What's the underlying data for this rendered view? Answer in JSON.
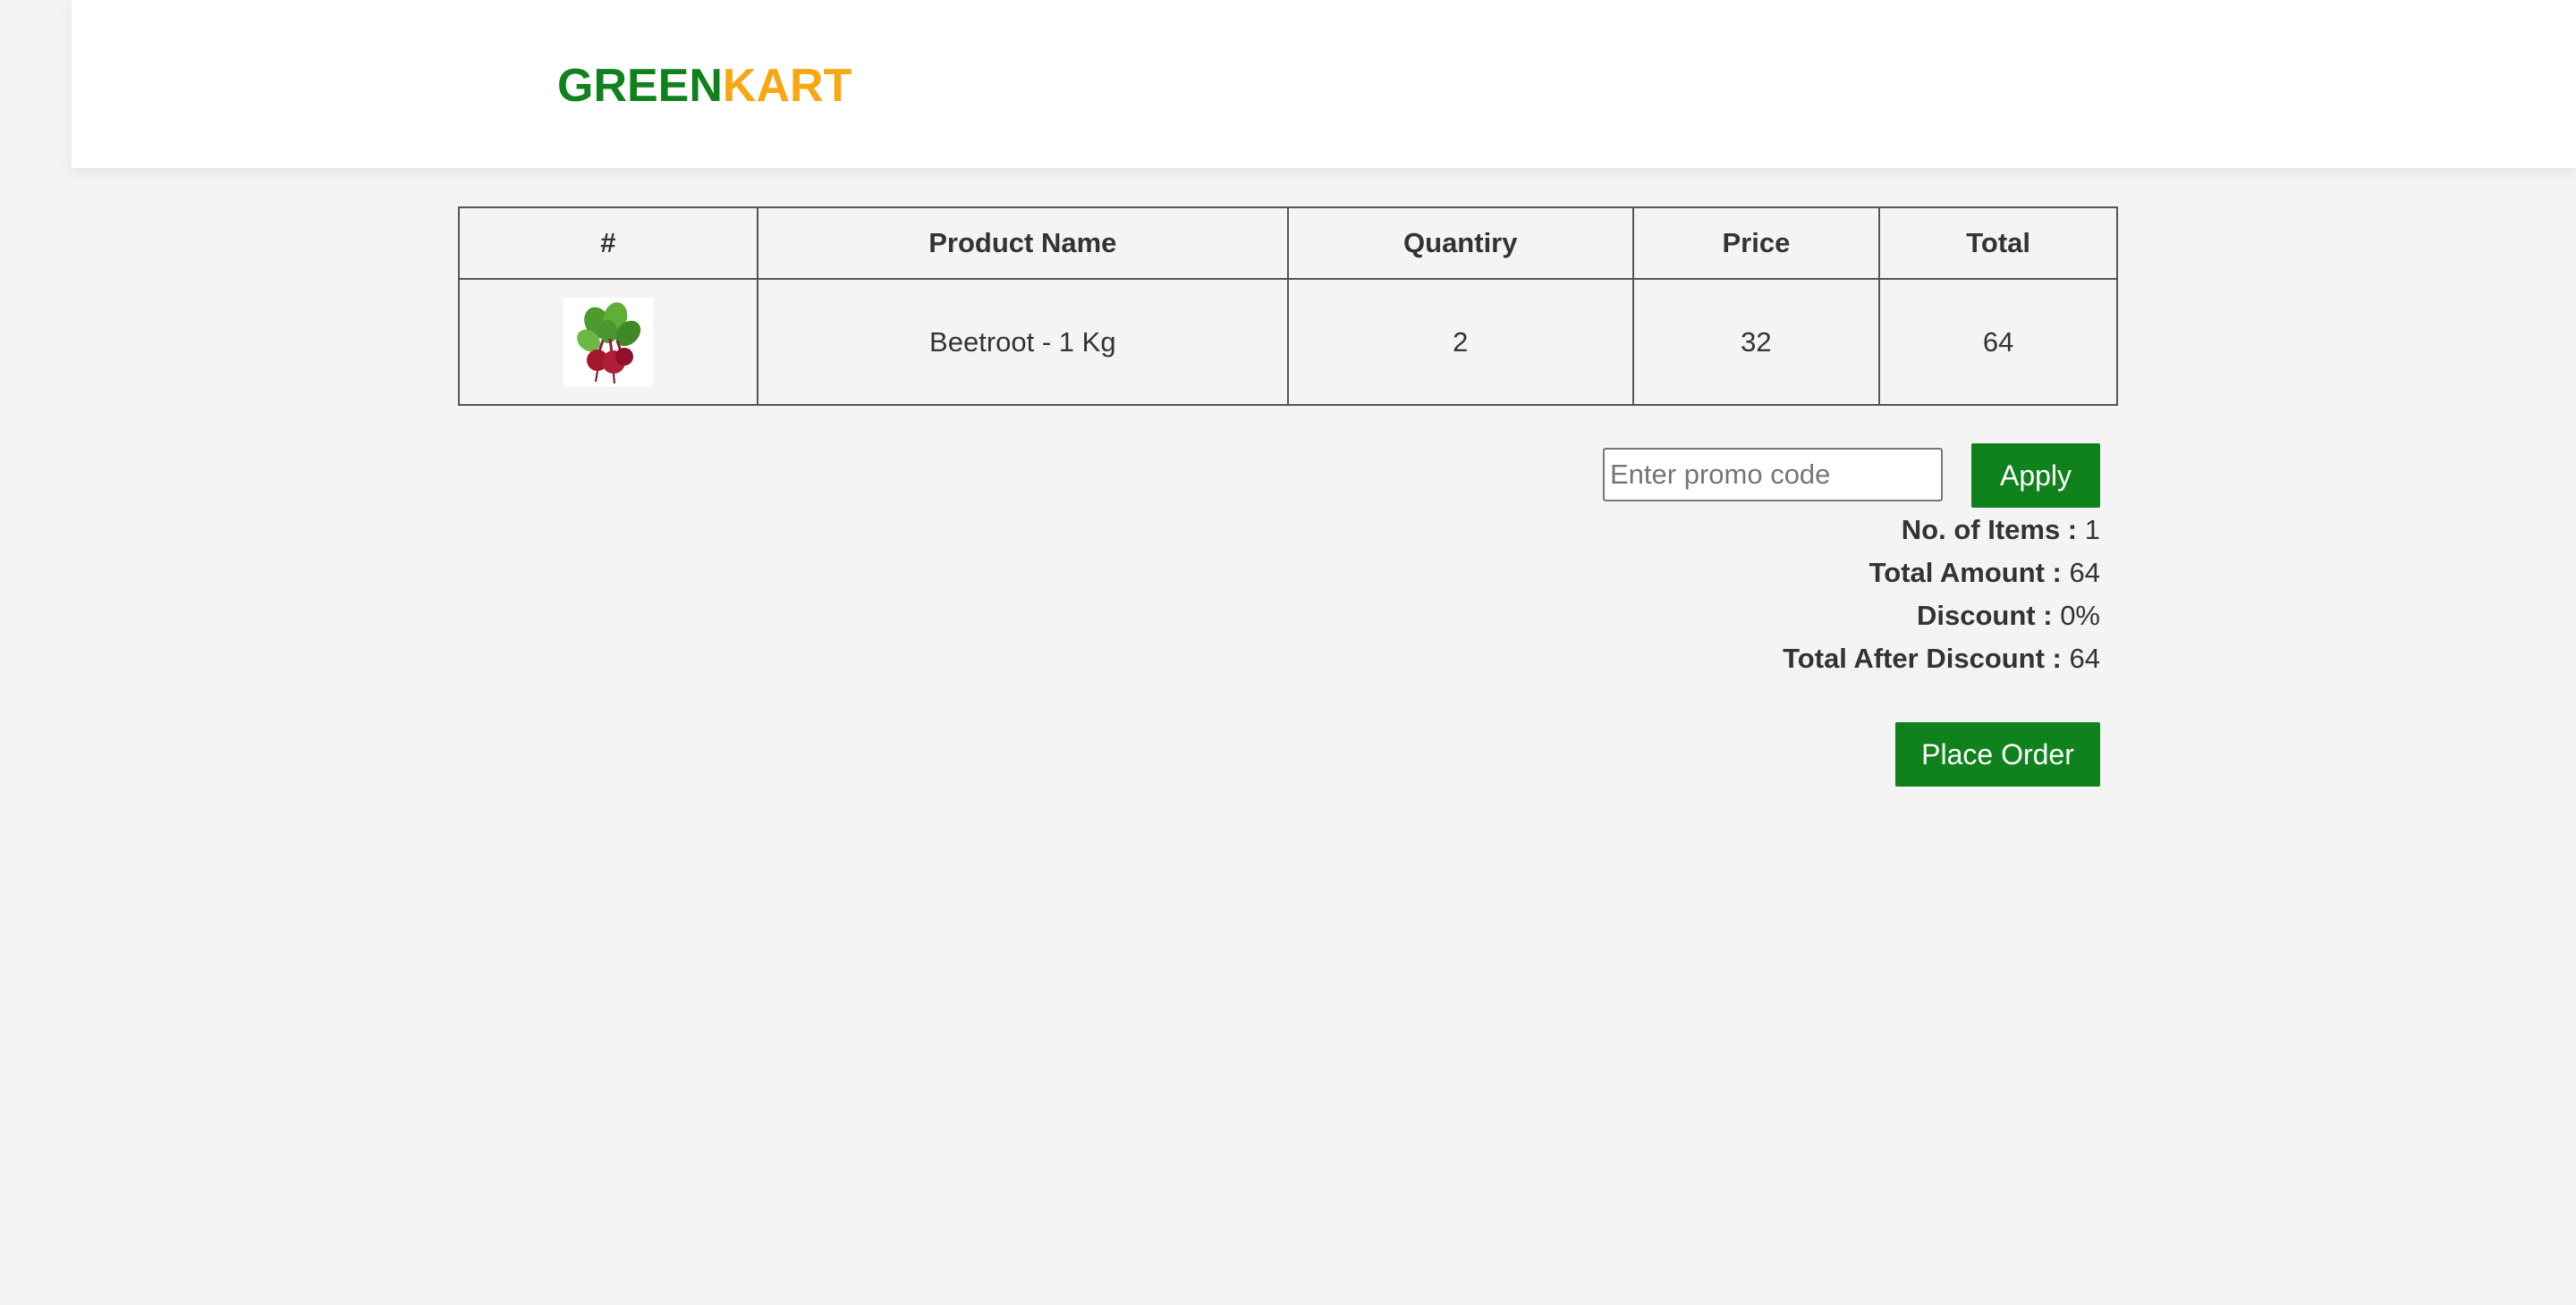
{
  "brand": {
    "part1": "GREEN",
    "part2": "KART"
  },
  "table": {
    "headers": [
      "#",
      "Product Name",
      "Quantiry",
      "Price",
      "Total"
    ],
    "rows": [
      {
        "image_icon": "beetroot-image",
        "name": "Beetroot - 1 Kg",
        "quantity": "2",
        "price": "32",
        "total": "64"
      }
    ]
  },
  "promo": {
    "placeholder": "Enter promo code",
    "value": "",
    "apply_label": "Apply"
  },
  "summary": {
    "items_label": "No. of Items :",
    "items_value": "1",
    "amount_label": "Total Amount :",
    "amount_value": "64",
    "discount_label": "Discount :",
    "discount_value": "0%",
    "after_label": "Total After Discount :",
    "after_value": "64"
  },
  "place_order_label": "Place Order",
  "colors": {
    "brand_green": "#10821d",
    "brand_orange": "#f7a711",
    "background": "#f4f4f4"
  }
}
